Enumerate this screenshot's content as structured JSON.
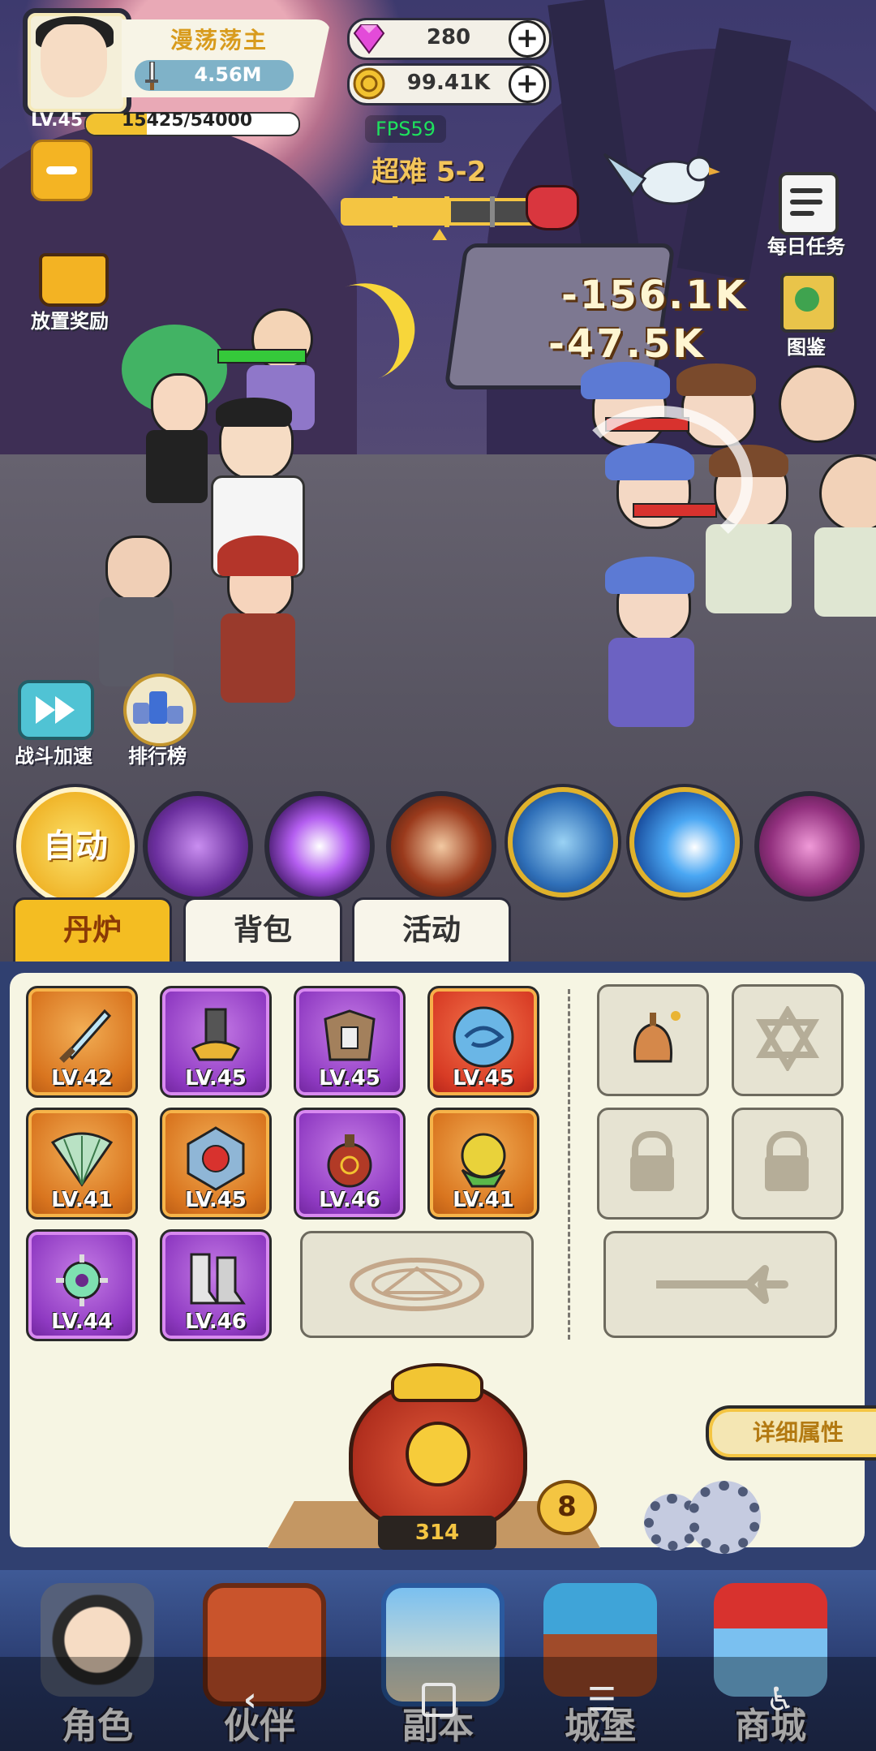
{
  "player": {
    "name": "漫荡荡主",
    "power": "4.56M",
    "level": "LV.45",
    "xp_text": "15425/54000",
    "xp_fraction": 0.2856
  },
  "currency": {
    "gems": "280",
    "coins": "99.41K",
    "gem_color": "#e34bd9",
    "coin_color": "#f2c230"
  },
  "fps": "FPS59",
  "stage": {
    "label": "超难 5-2",
    "progress_fraction": 0.55
  },
  "left_buttons": {
    "idle_reward": "放置奖励",
    "battle_speed": "战斗加速",
    "leaderboard": "排行榜"
  },
  "right_buttons": {
    "daily_tasks": "每日任务",
    "encyclopedia": "图鉴"
  },
  "damage_numbers": [
    "-156.1K",
    "-47.5K"
  ],
  "skills": {
    "auto_label": "自动",
    "icons": [
      "purple-swirl-skill-icon",
      "purple-lightning-skill-icon",
      "fire-tornado-skill-icon",
      "ice-shield-skill-icon",
      "blue-fireball-skill-icon",
      "magenta-vortex-skill-icon"
    ]
  },
  "tabs": [
    "丹炉",
    "背包",
    "活动"
  ],
  "equipment": [
    {
      "level": "LV.42",
      "rarity": "orange",
      "icon": "sword-icon"
    },
    {
      "level": "LV.45",
      "rarity": "purple",
      "icon": "helmet-icon"
    },
    {
      "level": "LV.45",
      "rarity": "purple",
      "icon": "armor-icon"
    },
    {
      "level": "LV.45",
      "rarity": "red",
      "icon": "dragon-orb-icon"
    },
    {
      "level": "LV.41",
      "rarity": "orange",
      "icon": "fan-icon"
    },
    {
      "level": "LV.45",
      "rarity": "orange",
      "icon": "shield-icon"
    },
    {
      "level": "LV.46",
      "rarity": "purple",
      "icon": "gourd-icon"
    },
    {
      "level": "LV.41",
      "rarity": "orange",
      "icon": "pill-icon"
    },
    {
      "level": "LV.44",
      "rarity": "purple",
      "icon": "jade-icon"
    },
    {
      "level": "LV.46",
      "rarity": "purple",
      "icon": "boots-icon"
    }
  ],
  "furnace": {
    "count": "314",
    "badge": "8"
  },
  "detail_button": "详细属性",
  "nav": [
    "角色",
    "伙伴",
    "副本",
    "城堡",
    "商城"
  ],
  "system_nav": [
    "back-icon",
    "home-icon",
    "menu-icon",
    "accessibility-icon"
  ]
}
